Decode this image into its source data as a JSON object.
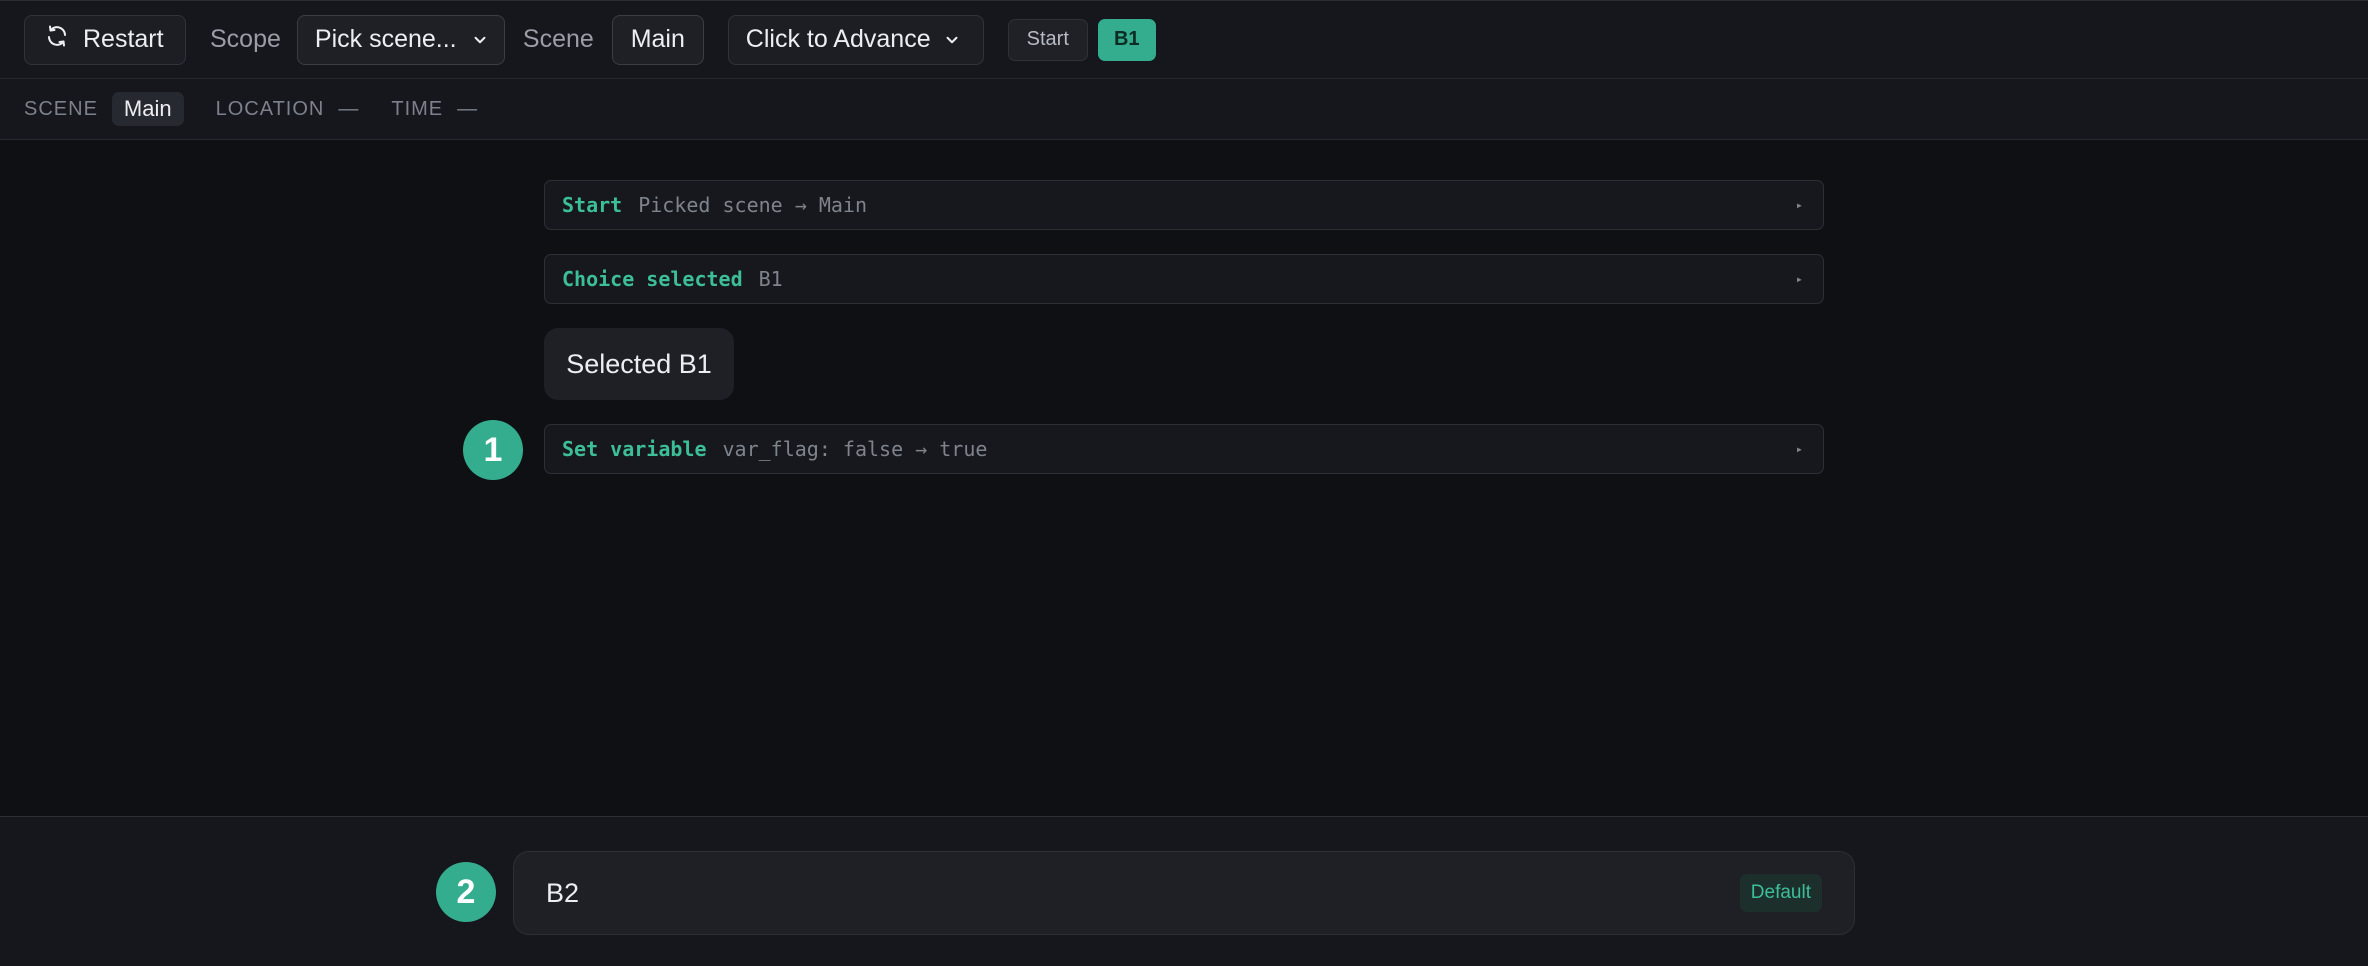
{
  "toolbar": {
    "restart_label": "Restart",
    "scope_label": "Scope",
    "scope_value": "Pick scene...",
    "scene_label": "Scene",
    "scene_value": "Main",
    "advance_mode": "Click to Advance",
    "breadcrumbs": [
      {
        "label": "Start",
        "active": false
      },
      {
        "label": "B1",
        "active": true
      }
    ]
  },
  "info": {
    "scene_key": "SCENE",
    "scene_value": "Main",
    "location_key": "LOCATION",
    "location_value": "—",
    "time_key": "TIME",
    "time_value": "—"
  },
  "log": {
    "entries": [
      {
        "kind": "Start",
        "detail": "Picked scene → Main",
        "caret": "▸"
      },
      {
        "kind": "Choice selected",
        "detail": "B1",
        "caret": "▸"
      },
      {
        "kind": "Set variable",
        "detail": "var_flag: false → true",
        "caret": "▸"
      }
    ],
    "message": "Selected B1",
    "badges": [
      "1",
      "2"
    ]
  },
  "choices": [
    {
      "label": "B2",
      "tag": "Default"
    }
  ],
  "colors": {
    "accent": "#34ad8e",
    "accent_text": "#3cbf98",
    "background": "#0f1014",
    "panel": "#15171d"
  },
  "icons": {
    "restart": "refresh-icon",
    "dropdown": "chevron-down-icon"
  }
}
